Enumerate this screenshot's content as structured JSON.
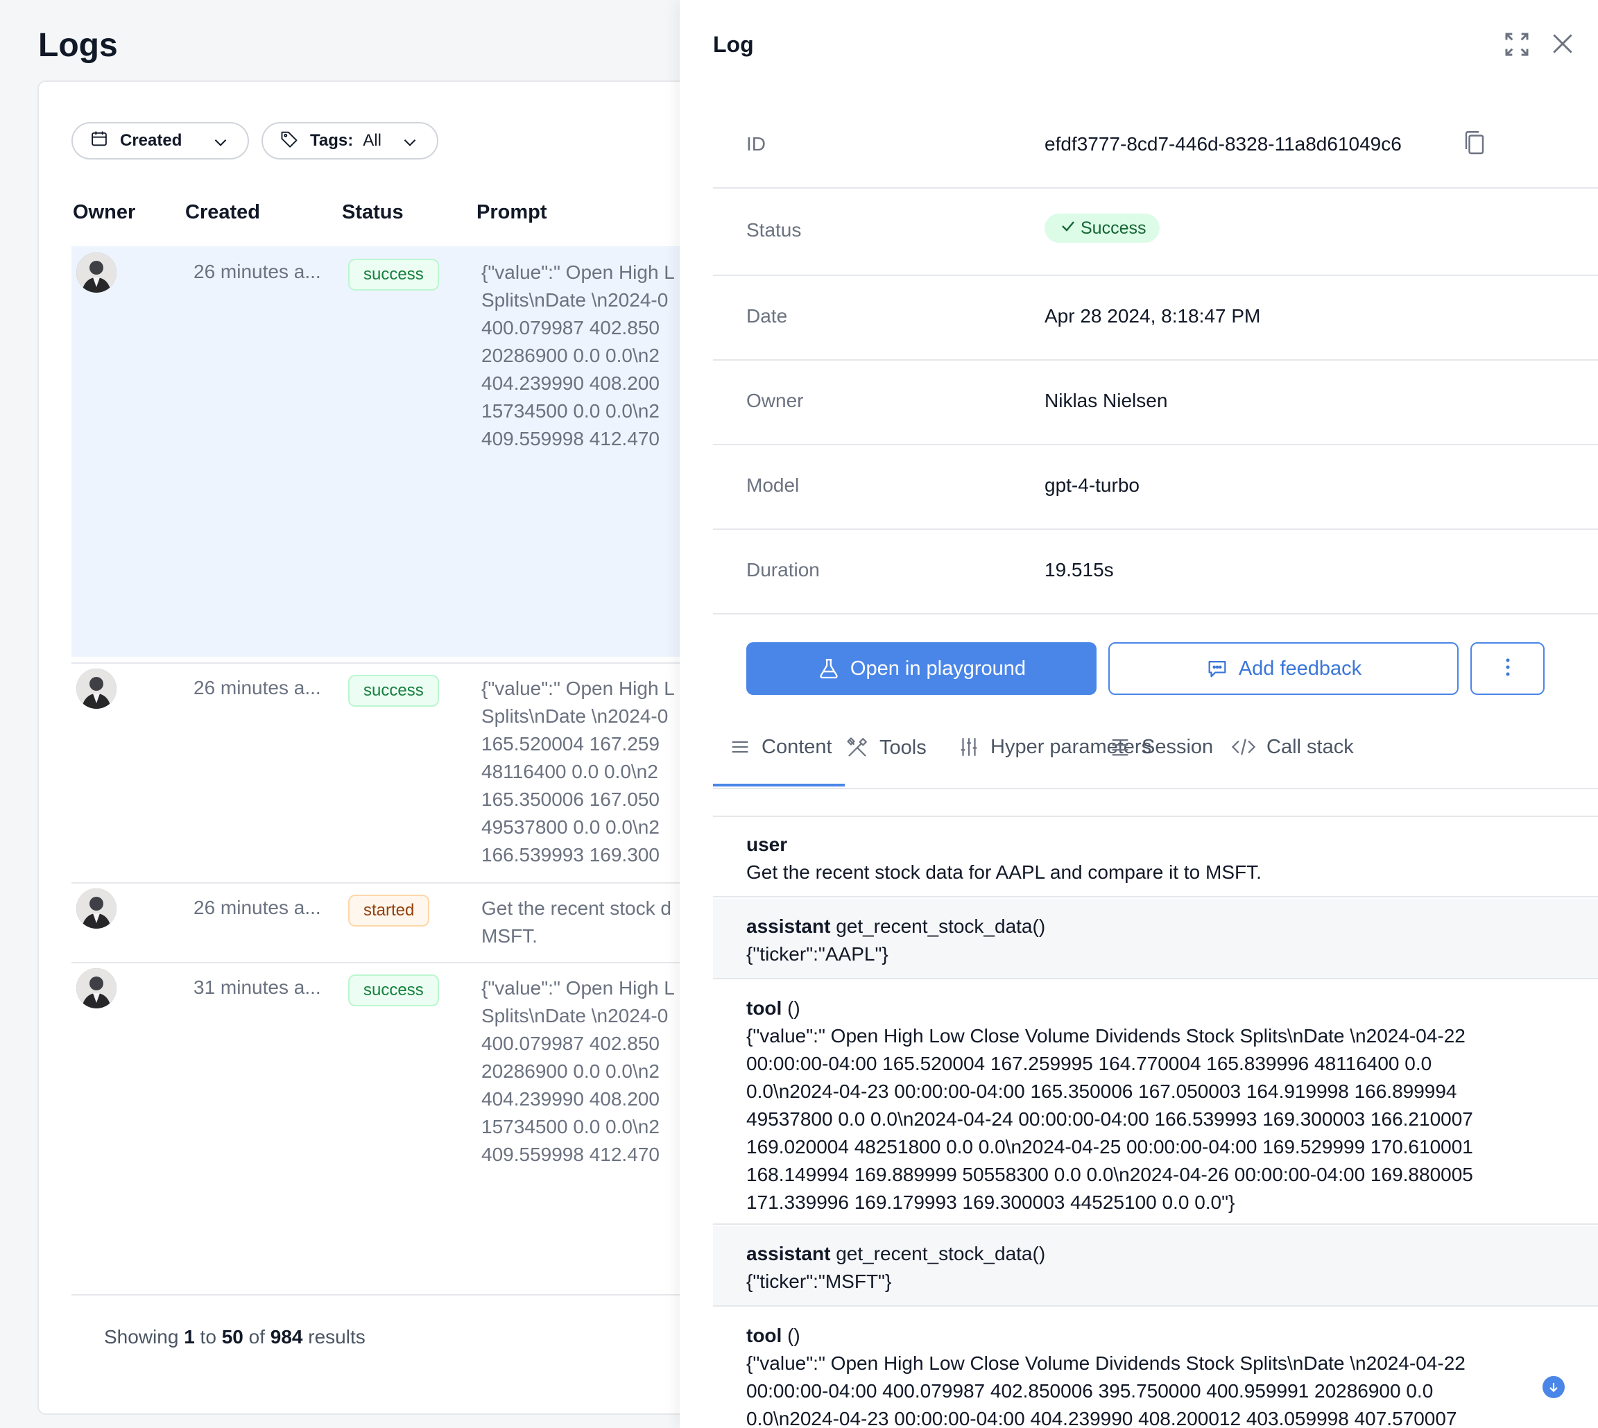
{
  "page": {
    "title": "Logs"
  },
  "filters": {
    "created_label": "Created",
    "tags_label": "Tags:",
    "tags_value": "All"
  },
  "table": {
    "columns": [
      "Owner",
      "Created",
      "Status",
      "Prompt"
    ],
    "rows": [
      {
        "created": "26 minutes a...",
        "status": "success",
        "prompt": "{\"value\":\" Open High L\nSplits\\nDate \\n2024-0\n400.079987 402.850\n20286900 0.0 0.0\\n2\n404.239990 408.200\n15734500 0.0 0.0\\n2\n409.559998 412.470"
      },
      {
        "created": "26 minutes a...",
        "status": "success",
        "prompt": "{\"value\":\" Open High L\nSplits\\nDate \\n2024-0\n165.520004 167.259\n48116400 0.0 0.0\\n2\n165.350006 167.050\n49537800 0.0 0.0\\n2\n166.539993 169.300"
      },
      {
        "created": "26 minutes a...",
        "status": "started",
        "prompt": "Get the recent stock d\nMSFT."
      },
      {
        "created": "31 minutes a...",
        "status": "success",
        "prompt": "{\"value\":\" Open High L\nSplits\\nDate \\n2024-0\n400.079987 402.850\n20286900 0.0 0.0\\n2\n404.239990 408.200\n15734500 0.0 0.0\\n2\n409.559998 412.470"
      }
    ]
  },
  "pagination": {
    "prefix": "Showing",
    "from": "1",
    "to_word": "to",
    "to": "50",
    "of_word": "of",
    "total": "984",
    "suffix": "results"
  },
  "drawer": {
    "title": "Log",
    "fields": {
      "id_label": "ID",
      "id_value": "efdf3777-8cd7-446d-8328-11a8d61049c6",
      "status_label": "Status",
      "status_value": "Success",
      "date_label": "Date",
      "date_value": "Apr 28 2024, 8:18:47 PM",
      "owner_label": "Owner",
      "owner_value": "Niklas Nielsen",
      "model_label": "Model",
      "model_value": "gpt-4-turbo",
      "duration_label": "Duration",
      "duration_value": "19.515s"
    },
    "actions": {
      "playground": "Open in playground",
      "feedback": "Add feedback"
    },
    "tabs": [
      "Content",
      "Tools",
      "Hyper parameters",
      "Session",
      "Call stack"
    ],
    "active_tab": "Content",
    "messages": [
      {
        "role": "user",
        "title": "",
        "body": "Get the recent stock data for AAPL and compare it to MSFT."
      },
      {
        "role": "assistant",
        "title": "get_recent_stock_data()",
        "body": "{\"ticker\":\"AAPL\"}"
      },
      {
        "role": "tool",
        "title": "()",
        "body": "{\"value\":\" Open High Low Close Volume Dividends Stock Splits\\nDate \\n2024-04-22\n00:00:00-04:00 165.520004 167.259995 164.770004 165.839996 48116400 0.0\n0.0\\n2024-04-23 00:00:00-04:00 165.350006 167.050003 164.919998 166.899994\n49537800 0.0 0.0\\n2024-04-24 00:00:00-04:00 166.539993 169.300003 166.210007\n169.020004 48251800 0.0 0.0\\n2024-04-25 00:00:00-04:00 169.529999 170.610001\n168.149994 169.889999 50558300 0.0 0.0\\n2024-04-26 00:00:00-04:00 169.880005\n171.339996 169.179993 169.300003 44525100 0.0 0.0\"}"
      },
      {
        "role": "assistant",
        "title": "get_recent_stock_data()",
        "body": "{\"ticker\":\"MSFT\"}"
      },
      {
        "role": "tool",
        "title": "()",
        "body": "{\"value\":\" Open High Low Close Volume Dividends Stock Splits\\nDate \\n2024-04-22\n00:00:00-04:00 400.079987 402.850006 395.750000 400.959991 20286900 0.0\n0.0\\n2024-04-23 00:00:00-04:00 404.239990 408.200012 403.059998 407.570007"
      }
    ]
  }
}
